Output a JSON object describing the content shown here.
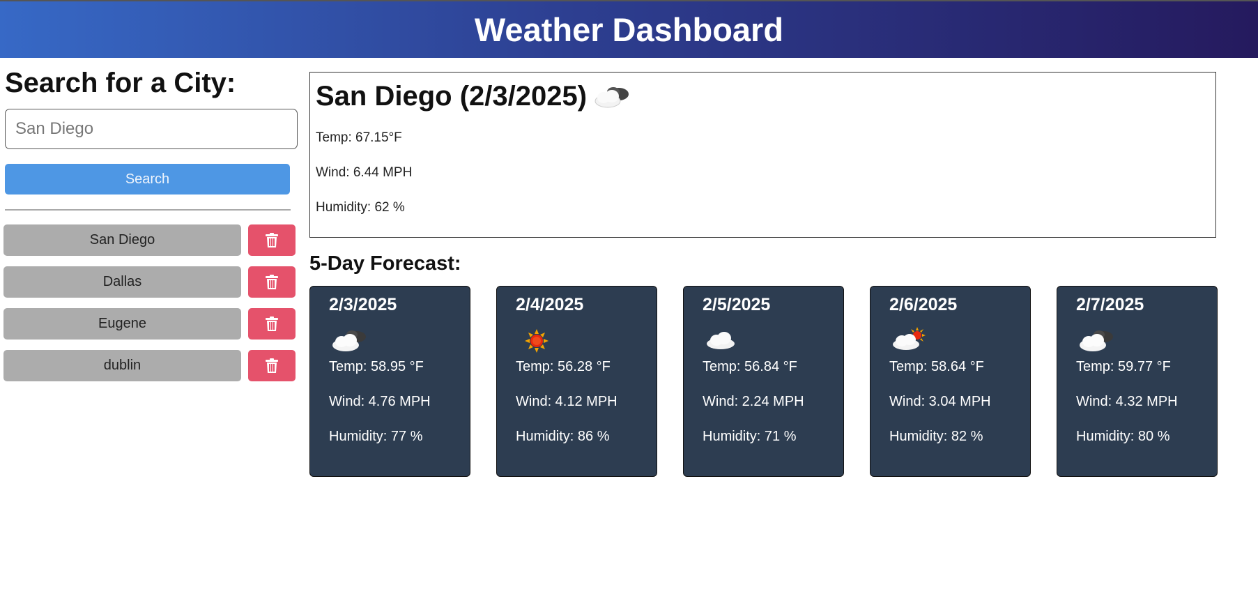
{
  "header": {
    "title": "Weather Dashboard"
  },
  "sidebar": {
    "heading": "Search for a City:",
    "search_value": "San Diego",
    "search_button": "Search",
    "history": [
      {
        "city": "San Diego"
      },
      {
        "city": "Dallas"
      },
      {
        "city": "Eugene"
      },
      {
        "city": "dublin"
      }
    ]
  },
  "current": {
    "title": "San Diego (2/3/2025)",
    "icon": "partly-cloudy-icon",
    "temp": "Temp: 67.15°F",
    "wind": "Wind: 6.44 MPH",
    "humidity": "Humidity: 62 %"
  },
  "forecast": {
    "heading": "5-Day Forecast:",
    "days": [
      {
        "date": "2/3/2025",
        "icon": "cloud-with-dark-cloud-icon",
        "temp": "Temp: 58.95 °F",
        "wind": "Wind: 4.76 MPH",
        "humidity": "Humidity: 77 %"
      },
      {
        "date": "2/4/2025",
        "icon": "sun-icon",
        "temp": "Temp: 56.28 °F",
        "wind": "Wind: 4.12 MPH",
        "humidity": "Humidity: 86 %"
      },
      {
        "date": "2/5/2025",
        "icon": "cloud-icon",
        "temp": "Temp: 56.84 °F",
        "wind": "Wind: 2.24 MPH",
        "humidity": "Humidity: 71 %"
      },
      {
        "date": "2/6/2025",
        "icon": "sun-behind-cloud-icon",
        "temp": "Temp: 58.64 °F",
        "wind": "Wind: 3.04 MPH",
        "humidity": "Humidity: 82 %"
      },
      {
        "date": "2/7/2025",
        "icon": "cloud-with-dark-cloud-icon",
        "temp": "Temp: 59.77 °F",
        "wind": "Wind: 4.32 MPH",
        "humidity": "Humidity: 80 %"
      }
    ]
  },
  "colors": {
    "header_start": "#3769c6",
    "header_end": "#251a5e",
    "search_button": "#4e97e4",
    "history_button": "#acacac",
    "delete_button": "#e5526b",
    "card_bg": "#2d3d51"
  }
}
